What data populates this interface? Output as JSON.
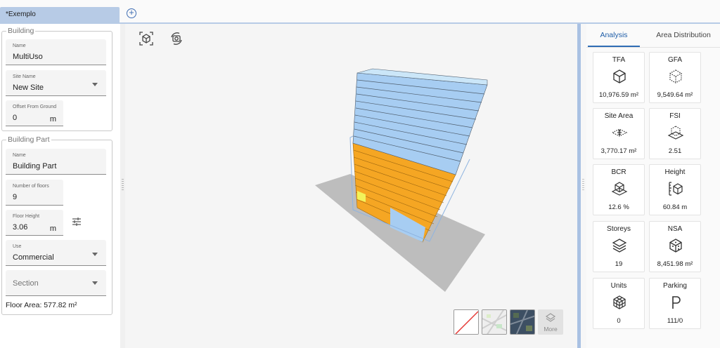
{
  "tabs": {
    "active_label": "*Exemplo"
  },
  "building": {
    "legend": "Building",
    "name_label": "Name",
    "name_value": "MultiUso",
    "site_label": "Site Name",
    "site_value": "New Site",
    "offset_label": "Offset From Ground",
    "offset_value": "0",
    "offset_unit": "m"
  },
  "building_part": {
    "legend": "Building Part",
    "name_label": "Name",
    "name_value": "Building Part",
    "floors_label": "Number of floors",
    "floors_value": "9",
    "height_label": "Floor Height",
    "height_value": "3.06",
    "height_unit": "m",
    "use_label": "Use",
    "use_value": "Commercial",
    "section_placeholder": "Section",
    "floor_area": "Floor Area: 577.82 m²"
  },
  "viewport": {
    "more_label": "More"
  },
  "analysis": {
    "tabs": [
      "Analysis",
      "Area Distribution"
    ],
    "metrics": [
      {
        "title": "TFA",
        "value": "10,976.59 m²",
        "icon": "cube-solid-icon"
      },
      {
        "title": "GFA",
        "value": "9,549.64 m²",
        "icon": "cube-dotted-icon"
      },
      {
        "title": "Site Area",
        "value": "3,770.17 m²",
        "icon": "site-area-icon"
      },
      {
        "title": "FSI",
        "value": "2.51",
        "icon": "fsi-icon"
      },
      {
        "title": "BCR",
        "value": "12.6 %",
        "icon": "bcr-icon"
      },
      {
        "title": "Height",
        "value": "60.84 m",
        "icon": "height-icon"
      },
      {
        "title": "Storeys",
        "value": "19",
        "icon": "layers-icon"
      },
      {
        "title": "NSA",
        "value": "8,451.98 m²",
        "icon": "nsa-icon"
      },
      {
        "title": "Units",
        "value": "0",
        "icon": "units-icon"
      },
      {
        "title": "Parking",
        "value": "111/0",
        "icon": "parking-icon"
      }
    ]
  },
  "colors": {
    "accent": "#2f6db5",
    "tab": "#b7cbe6",
    "upper_floors": "#a7cdf2",
    "lower_floors": "#f5a623",
    "ground": "#bdbdbd"
  }
}
